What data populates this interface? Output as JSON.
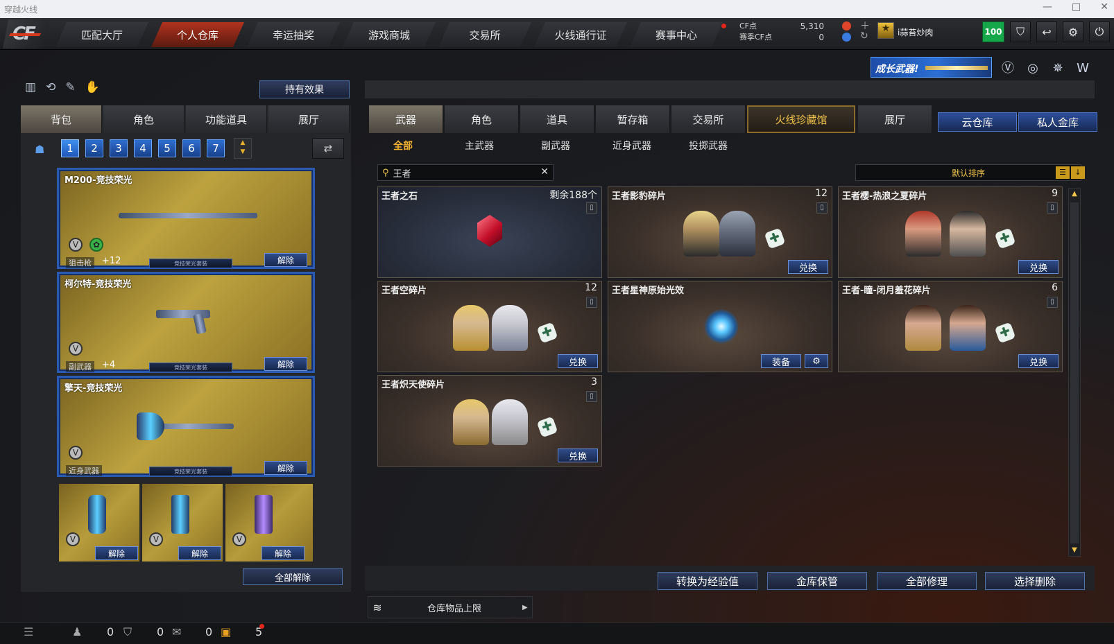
{
  "window": {
    "title": "穿越火线",
    "controls": [
      "—",
      "□",
      "✕"
    ]
  },
  "nav": {
    "tabs": [
      "匹配大厅",
      "个人仓库",
      "幸运抽奖",
      "游戏商城",
      "交易所",
      "火线通行证",
      "赛事中心"
    ],
    "active": "个人仓库"
  },
  "points": {
    "cf_label": "CF点",
    "cf_value": "5,310",
    "season_label": "赛季CF点",
    "season_value": "0"
  },
  "user": {
    "name": "i蒜苔炒肉",
    "level": "100"
  },
  "banner": {
    "text": "成长武器!"
  },
  "left": {
    "effect_button": "持有效果",
    "tabs": [
      "背包",
      "角色",
      "功能道具",
      "展厅"
    ],
    "pages": [
      "1",
      "2",
      "3",
      "4",
      "5",
      "6",
      "7"
    ],
    "weapons": [
      {
        "name": "M200-竞技荣光",
        "category": "狙击枪",
        "level": "+12",
        "ribbon": "竞技荣光套装",
        "remove": "解除"
      },
      {
        "name": "柯尔特-竞技荣光",
        "category": "副武器",
        "level": "+4",
        "ribbon": "竞技荣光套装",
        "remove": "解除"
      },
      {
        "name": "擎天-竞技荣光",
        "category": "近身武器",
        "level": "",
        "ribbon": "竞技荣光套装",
        "remove": "解除"
      }
    ],
    "throwables": [
      {
        "remove": "解除"
      },
      {
        "remove": "解除"
      },
      {
        "remove": "解除"
      }
    ],
    "remove_all": "全部解除"
  },
  "right": {
    "tabs": [
      "武器",
      "角色",
      "道具",
      "暂存箱",
      "交易所",
      "火线珍藏馆",
      "展厅"
    ],
    "cloud_tabs": [
      "云仓库",
      "私人金库"
    ],
    "subtabs": [
      "全部",
      "主武器",
      "副武器",
      "近身武器",
      "投掷武器"
    ],
    "search": {
      "value": "王者"
    },
    "sort": {
      "label": "默认排序"
    },
    "items": [
      {
        "name": "王者之石",
        "qty": "剩余188个",
        "action": ""
      },
      {
        "name": "王者影豹碎片",
        "qty": "12",
        "action": "兑换"
      },
      {
        "name": "王者樱-热浪之夏碎片",
        "qty": "9",
        "action": "兑换"
      },
      {
        "name": "王者空碎片",
        "qty": "12",
        "action": "兑换"
      },
      {
        "name": "王者星神原始光效",
        "qty": "",
        "action": "装备"
      },
      {
        "name": "王者-瞳-闭月羞花碎片",
        "qty": "6",
        "action": "兑换"
      },
      {
        "name": "王者炽天使碎片",
        "qty": "3",
        "action": "兑换"
      }
    ],
    "buttons": [
      "转换为经验值",
      "金库保管",
      "全部修理",
      "选择删除"
    ],
    "capacity": "仓库物品上限"
  },
  "status": {
    "a": "0",
    "b": "0",
    "c": "0",
    "d": "5"
  },
  "colors": {
    "accent": "#b1331e",
    "gold": "#f1c34a",
    "blue": "#2f4c8a",
    "green": "#15a74a"
  }
}
